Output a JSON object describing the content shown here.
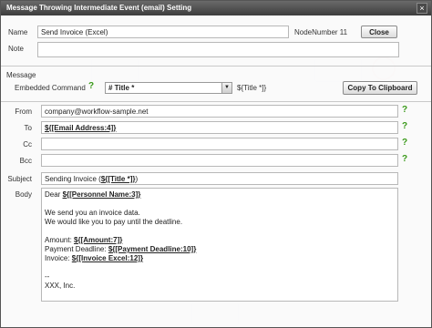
{
  "window": {
    "title": "Message Throwing Intermediate Event (email) Setting",
    "close_glyph": "×"
  },
  "form": {
    "name_label": "Name",
    "name_value": "Send Invoice (Excel)",
    "node_number": "NodeNumber 11",
    "close_button": "Close",
    "note_label": "Note",
    "note_value": "",
    "message_label": "Message",
    "embedded_label": "Embedded Command",
    "embedded_selected": "# Title *",
    "embedded_preview": "${Title *]}",
    "copy_button": "Copy To Clipboard",
    "from_label": "From",
    "from_value": "company@workflow-sample.net",
    "to_label": "To",
    "to_value": "${[Email Address:4]}",
    "cc_label": "Cc",
    "cc_value": "",
    "bcc_label": "Bcc",
    "bcc_value": "",
    "subject_label": "Subject",
    "subject_prefix": "Sending Invoice (",
    "subject_var": "${[Title *]}",
    "subject_suffix": ")",
    "body_label": "Body",
    "help_glyph": "?"
  },
  "body": {
    "dear_prefix": "Dear ",
    "dear_var": "${[Personnel Name:3]}",
    "line2": "We send you an invoice data.",
    "line3": "We would like you to pay until the deatline.",
    "amount_label": "Amount: ",
    "amount_var": "${[Amount:7]}",
    "deadline_label": "Payment Deadline: ",
    "deadline_var": "${[Payment Deadline:10]}",
    "invoice_label": "Invoice: ",
    "invoice_var": "${[Invoice Excel:12]}",
    "sig1": "--",
    "sig2": "XXX, Inc."
  }
}
